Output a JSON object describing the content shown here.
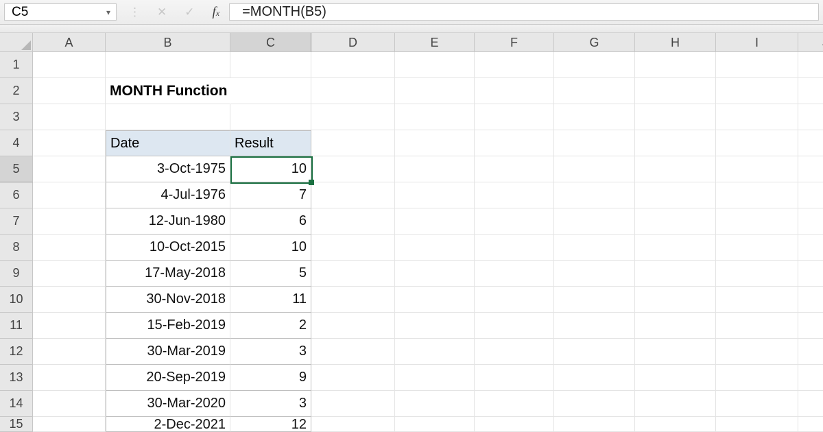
{
  "formula_bar": {
    "cell_ref": "C5",
    "formula": "=MONTH(B5)"
  },
  "columns": [
    "A",
    "B",
    "C",
    "D",
    "E",
    "F",
    "G",
    "H",
    "I",
    "J"
  ],
  "rows": [
    "1",
    "2",
    "3",
    "4",
    "5",
    "6",
    "7",
    "8",
    "9",
    "10",
    "11",
    "12",
    "13",
    "14",
    "15"
  ],
  "title": "MONTH Function",
  "table": {
    "headers": {
      "date": "Date",
      "result": "Result"
    },
    "rows": [
      {
        "date": "3-Oct-1975",
        "result": "10"
      },
      {
        "date": "4-Jul-1976",
        "result": "7"
      },
      {
        "date": "12-Jun-1980",
        "result": "6"
      },
      {
        "date": "10-Oct-2015",
        "result": "10"
      },
      {
        "date": "17-May-2018",
        "result": "5"
      },
      {
        "date": "30-Nov-2018",
        "result": "11"
      },
      {
        "date": "15-Feb-2019",
        "result": "2"
      },
      {
        "date": "30-Mar-2019",
        "result": "3"
      },
      {
        "date": "20-Sep-2019",
        "result": "9"
      },
      {
        "date": "30-Mar-2020",
        "result": "3"
      },
      {
        "date": "2-Dec-2021",
        "result": "12"
      }
    ]
  },
  "active_cell": "C5"
}
